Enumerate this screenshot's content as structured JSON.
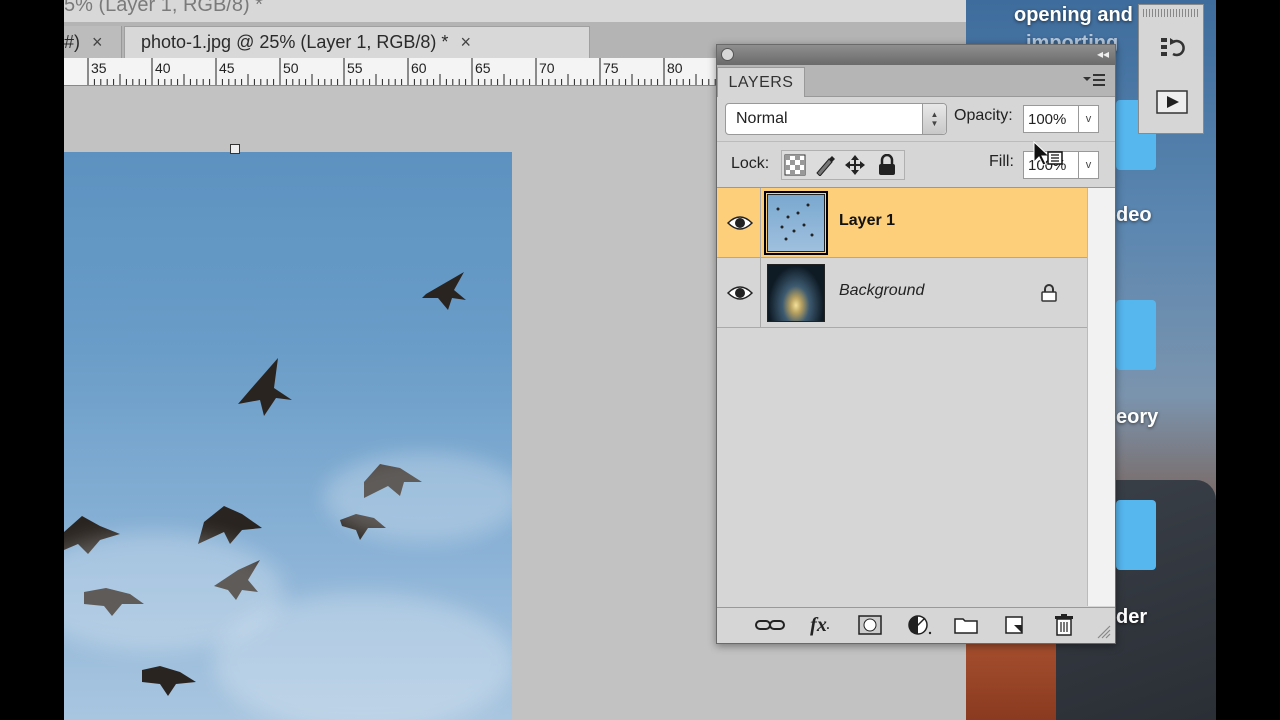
{
  "window": {
    "title_partial": "5% (Layer 1, RGB/8) *"
  },
  "tabs": [
    {
      "label": "#)",
      "close": "×"
    },
    {
      "label": "photo-1.jpg @ 25% (Layer 1, RGB/8) *",
      "close": "×"
    }
  ],
  "ruler": {
    "ticks": [
      "35",
      "40",
      "45",
      "50",
      "55",
      "60",
      "65",
      "70",
      "75",
      "80"
    ]
  },
  "layers_panel": {
    "tab_label": "LAYERS",
    "blend_mode": "Normal",
    "opacity_label": "Opacity:",
    "opacity_value": "100%",
    "lock_label": "Lock:",
    "fill_label": "Fill:",
    "fill_value": "100%",
    "layers": [
      {
        "name": "Layer 1",
        "visible": true,
        "selected": true,
        "locked": false
      },
      {
        "name": "Background",
        "visible": true,
        "selected": false,
        "locked": true
      }
    ],
    "bottom_buttons": [
      "link-icon",
      "fx-icon",
      "mask-icon",
      "adjustment-icon",
      "folder-icon",
      "new-layer-icon",
      "trash-icon"
    ],
    "fx_label": "fx"
  },
  "desktop": {
    "labels": [
      "opening and",
      "importing",
      "deo",
      "eory",
      "der"
    ]
  },
  "colors": {
    "selected_layer": "#fdcf7a",
    "panel_bg": "#d6d6d6",
    "canvas_bg": "#c2c2c2"
  }
}
